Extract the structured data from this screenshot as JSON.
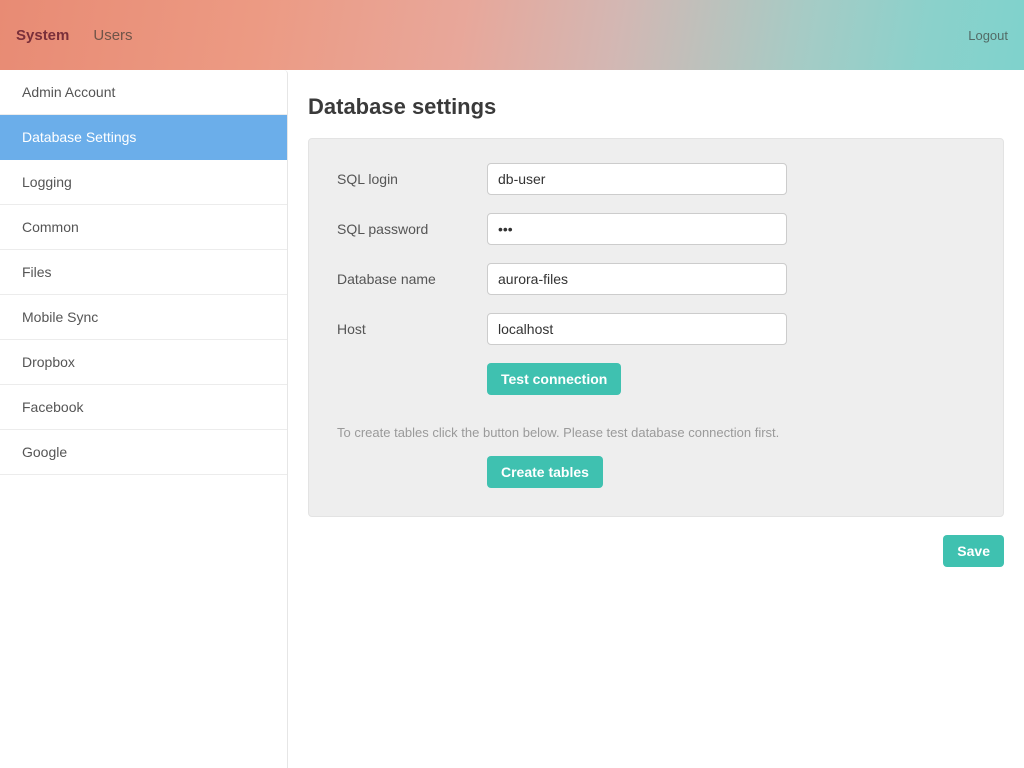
{
  "header": {
    "nav": [
      {
        "label": "System",
        "active": true
      },
      {
        "label": "Users",
        "active": false
      }
    ],
    "logout_label": "Logout"
  },
  "sidebar": {
    "items": [
      {
        "label": "Admin Account",
        "active": false
      },
      {
        "label": "Database Settings",
        "active": true
      },
      {
        "label": "Logging",
        "active": false
      },
      {
        "label": "Common",
        "active": false
      },
      {
        "label": "Files",
        "active": false
      },
      {
        "label": "Mobile Sync",
        "active": false
      },
      {
        "label": "Dropbox",
        "active": false
      },
      {
        "label": "Facebook",
        "active": false
      },
      {
        "label": "Google",
        "active": false
      }
    ]
  },
  "page": {
    "title": "Database settings",
    "fields": {
      "sql_login": {
        "label": "SQL login",
        "value": "db-user"
      },
      "sql_password": {
        "label": "SQL password",
        "value": "•••"
      },
      "database_name": {
        "label": "Database name",
        "value": "aurora-files"
      },
      "host": {
        "label": "Host",
        "value": "localhost"
      }
    },
    "buttons": {
      "test_connection": "Test connection",
      "create_tables": "Create tables",
      "save": "Save"
    },
    "hint": "To create tables click the button below. Please test database connection first."
  }
}
